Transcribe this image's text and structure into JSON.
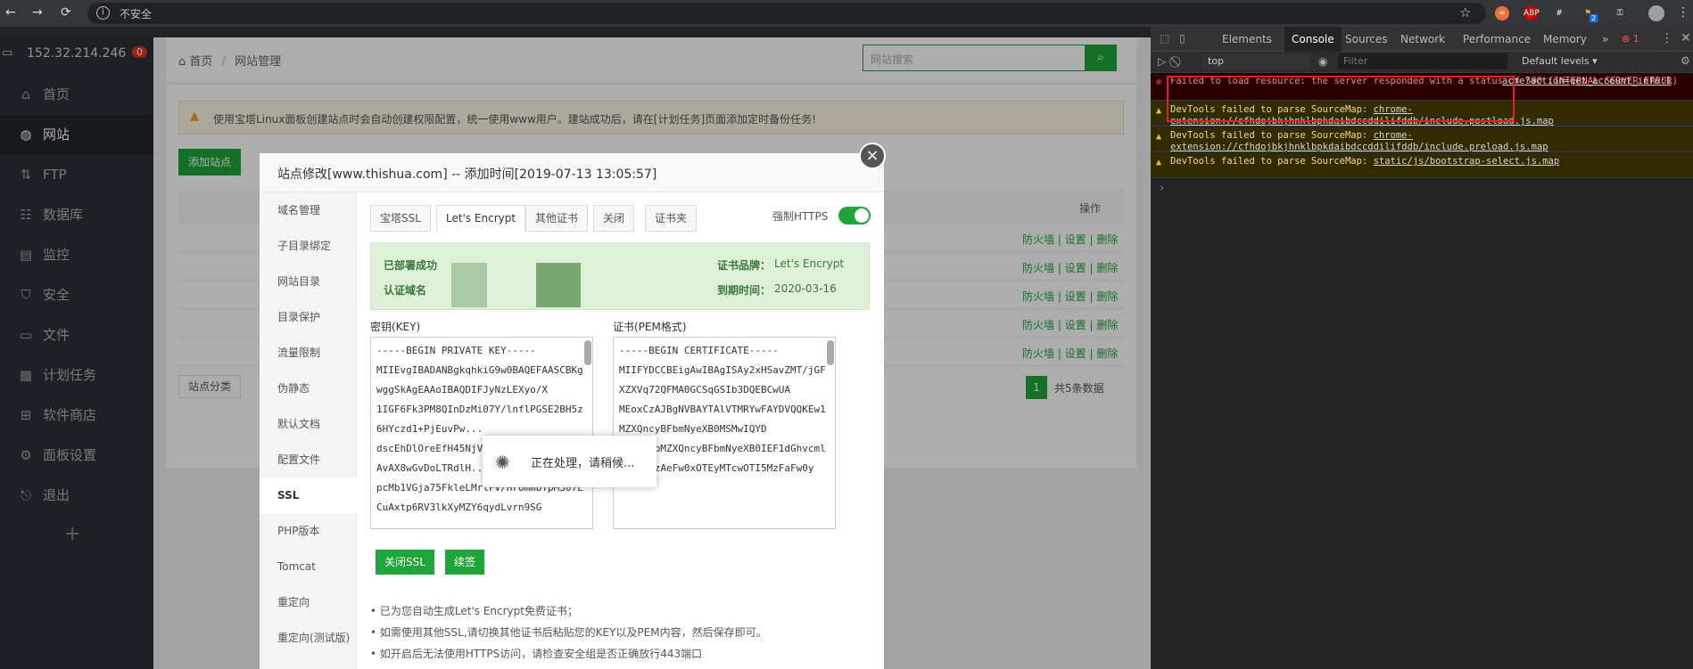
{
  "browser": {
    "url_text": "不安全",
    "nav": {
      "back": "←",
      "forward": "→",
      "reload": "⟳"
    },
    "ext_badge": "2",
    "extensions": [
      "∞",
      "ABP",
      "#",
      "⚑",
      "⚿"
    ]
  },
  "sidebar": {
    "ip": "152.32.214.246",
    "badge": "0",
    "items": [
      {
        "label": "首页",
        "icon": "home-icon"
      },
      {
        "label": "网站",
        "icon": "globe-icon"
      },
      {
        "label": "FTP",
        "icon": "ftp-icon"
      },
      {
        "label": "数据库",
        "icon": "database-icon"
      },
      {
        "label": "监控",
        "icon": "monitor-icon"
      },
      {
        "label": "安全",
        "icon": "shield-icon"
      },
      {
        "label": "文件",
        "icon": "folder-icon"
      },
      {
        "label": "计划任务",
        "icon": "calendar-icon"
      },
      {
        "label": "软件商店",
        "icon": "store-icon"
      },
      {
        "label": "面板设置",
        "icon": "settings-icon"
      },
      {
        "label": "退出",
        "icon": "logout-icon"
      }
    ],
    "add": "+"
  },
  "breadcrumb": {
    "home": "首页",
    "sep": "/",
    "current": "网站管理"
  },
  "search": {
    "placeholder": "网站搜索"
  },
  "notice": "使用宝塔Linux面板创建站点时会自动创建权限配置，统一使用www用户。建站成功后，请在[计划任务]页面添加定时备份任务!",
  "add_site": "添加站点",
  "table": {
    "ops_header": "操作",
    "row_ops": "防火墙 | 设置 | 删除",
    "category": "站点分类",
    "page": "1",
    "total": "共5条数据"
  },
  "modal": {
    "title": "站点修改[www.thishua.com] -- 添加时间[2019-07-13 13:05:57]",
    "close": "×",
    "nav": [
      "域名管理",
      "子目录绑定",
      "网站目录",
      "目录保护",
      "流量限制",
      "伪静态",
      "默认文档",
      "配置文件",
      "SSL",
      "PHP版本",
      "Tomcat",
      "重定向",
      "重定向(测试版)"
    ],
    "tabs": [
      "宝塔SSL",
      "Let's Encrypt",
      "其他证书",
      "关闭",
      "证书夹"
    ],
    "force_https": "强制HTTPS",
    "cert": {
      "deployed": "已部署成功",
      "domain_label": "认证域名",
      "brand_label": "证书品牌：",
      "brand": "Let's Encrypt",
      "expire_label": "到期时间：",
      "expire": "2020-03-16"
    },
    "key_label": "密钥(KEY)",
    "cert_label": "证书(PEM格式)",
    "key_text": "-----BEGIN PRIVATE KEY-----\nMIIEvgIBADANBgkqhkiG9w0BAQEFAASCBKgwggSkAgEAAoIBAQDIFJyNzLEXyo/X\n1IGF6Fk3PM8QInDzMi07Y/lnflPGSE2BH5z6HYczd1+PjEuvPw...\ndscEhDlOreEfH45NjVr...\nAvAX8wGvDoLTRdlH...\npcMb1VGja75FkleLMrlFV/HrOmmbYpM307LCuAxtp6RV3lkXyMZY6qydLvrn9SG",
    "cert_text": "-----BEGIN CERTIFICATE-----\nMIIFYDCCBEigAwIBAgISAy2xHSavZMT/jGFXZXVq72QFMA0GCSqGSIb3DQEBCwUA\nMEoxCzAJBgNVBAYTAlVTMRYwFAYDVQQKEw1MZXQncyBFbmNyeXB0MSMwIQYD\nVQQDExpMZXQncyBFbmNyeXB0IEF1dGhvcml0eSBYMzAeFw0xOTEyMTcwOTI5MzFaFw0y",
    "close_ssl": "关闭SSL",
    "renew": "续签",
    "tips": [
      "已为您自动生成Let's Encrypt免费证书；",
      "如需使用其他SSL,请切换其他证书后粘贴您的KEY以及PEM内容，然后保存即可。",
      "如开启后无法使用HTTPS访问，请检查安全组是否正确放行443端口"
    ],
    "loading": "正在处理，请稍候..."
  },
  "devtools": {
    "tabs": [
      "Elements",
      "Console",
      "Sources",
      "Network",
      "Performance",
      "Memory",
      "»"
    ],
    "error_count": "1",
    "context": "top",
    "filter_placeholder": "Filter",
    "levels": "Default levels ▾",
    "messages": [
      {
        "type": "error",
        "text": "Failed to load resource: the server responded with a status of 500 (INTERNAL SERVER ERROR)",
        "link": "acme?action=get_account_info:1"
      },
      {
        "type": "warning",
        "text": "DevTools failed to parse SourceMap: ",
        "link": "chrome-extension://cfhdojbkjhnklbpkdaibdccddilifddb/include.postload.js.map"
      },
      {
        "type": "warning",
        "text": "DevTools failed to parse SourceMap: ",
        "link": "chrome-extension://cfhdojbkjhnklbpkdaibdccddilifddb/include.preload.js.map"
      },
      {
        "type": "warning",
        "text": "DevTools failed to parse SourceMap: ",
        "link": "static/js/bootstrap-select.js.map"
      }
    ],
    "prompt": "›"
  }
}
